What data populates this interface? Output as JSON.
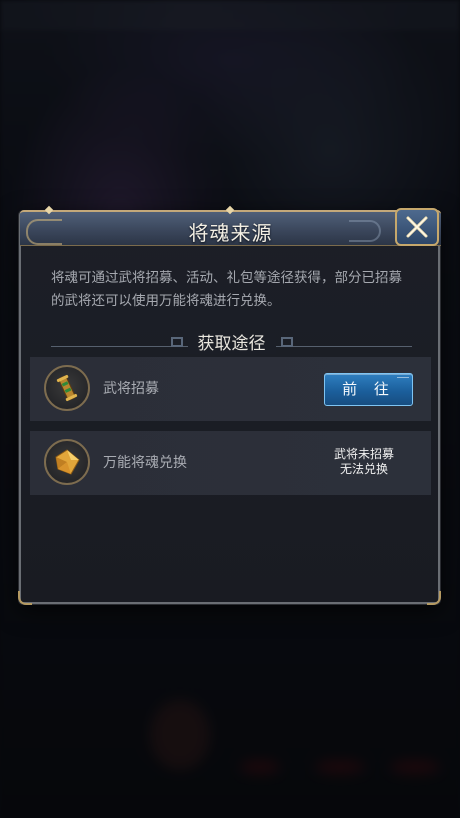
{
  "dialog": {
    "title": "将魂来源",
    "description": "将魂可通过武将招募、活动、礼包等途径获得，部分已招募的武将还可以使用万能将魂进行兑换。",
    "section_title": "获取途径",
    "close_icon": "close-x-icon"
  },
  "sources": [
    {
      "label": "武将招募",
      "icon": "recruit-scroll-icon",
      "action_label": "前 往"
    },
    {
      "label": "万能将魂兑换",
      "icon": "universal-soul-fragment-icon",
      "status_line1": "武将未招募",
      "status_line2": "无法兑换"
    }
  ],
  "colors": {
    "title_bar": "#3b475c",
    "frame_gold": "#c6a86c",
    "button_blue": "#1b5f9c"
  }
}
